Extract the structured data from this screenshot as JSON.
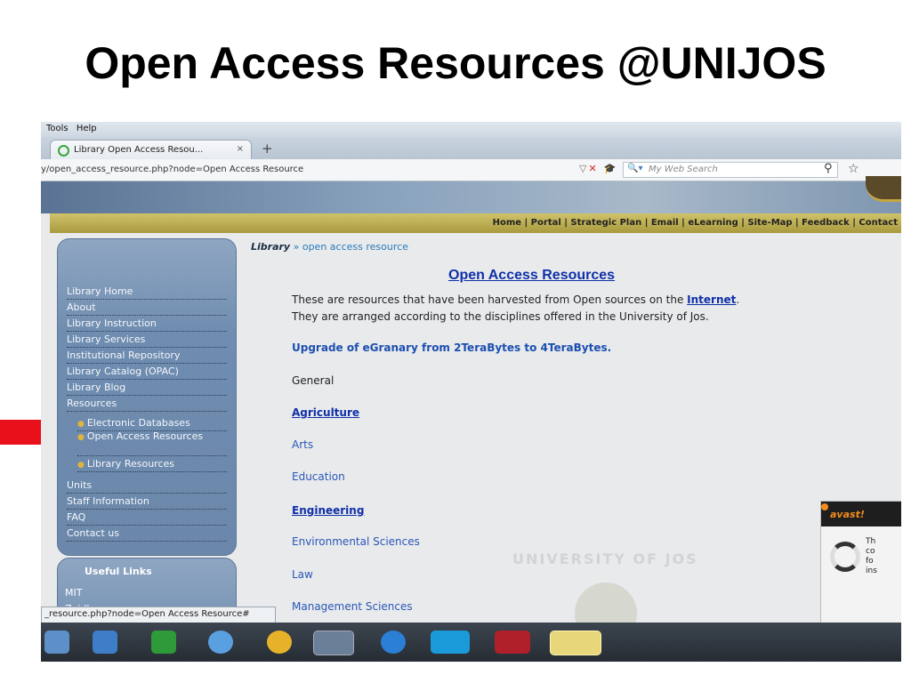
{
  "slide": {
    "title": "Open Access Resources @UNIJOS"
  },
  "browser": {
    "menu": [
      "Tools",
      "Help"
    ],
    "tab_title": "Library Open Access Resou...",
    "tab_close": "×",
    "new_tab": "+",
    "url": "y/open_access_resource.php?node=Open Access Resource",
    "search_placeholder": "My Web Search",
    "status_text": "_resource.php?node=Open Access Resource#"
  },
  "site": {
    "top_nav": "Home | Portal | Strategic Plan | Email | eLearning | Site-Map | Feedback | Contact",
    "breadcrumb_root": "Library",
    "breadcrumb_sep": " » ",
    "breadcrumb_current": "open access resource",
    "sidebar": {
      "items": [
        "Library Home",
        "About",
        "Library Instruction",
        "Library Services",
        "Institutional Repository",
        "Library Catalog (OPAC)",
        "Library Blog",
        "Resources"
      ],
      "sub_items": [
        "Electronic Databases",
        "Open Access Resources",
        "Library Resources"
      ],
      "items_after": [
        "Units",
        "Staff Information",
        "FAQ",
        "Contact us"
      ]
    },
    "useful_links": {
      "title": "Useful Links",
      "items": [
        "MIT",
        "Zaidlearn"
      ]
    },
    "main": {
      "title": "Open Access Resources",
      "intro_line1_a": "These are resources that have been harvested from Open sources on the ",
      "intro_link": "Internet",
      "intro_line1_b": ".",
      "intro_line2": "They are arranged according to the disciplines offered in the University of Jos.",
      "upgrade": "Upgrade of eGranary from 2TeraBytes to 4TeraBytes.",
      "disciplines": [
        "General",
        "Agriculture",
        "Arts",
        "Education",
        "Engineering",
        "Environmental Sciences",
        "Law",
        "Management Sciences"
      ]
    },
    "watermark_text": "UNIVERSITY OF JOS"
  },
  "avast": {
    "brand": "avast!",
    "text_lines": [
      "Th",
      "co",
      "fo",
      "ins"
    ]
  },
  "colors": {
    "arrow": "#e8101a",
    "link": "#1030a8",
    "sidebar": "#6f8db0"
  }
}
